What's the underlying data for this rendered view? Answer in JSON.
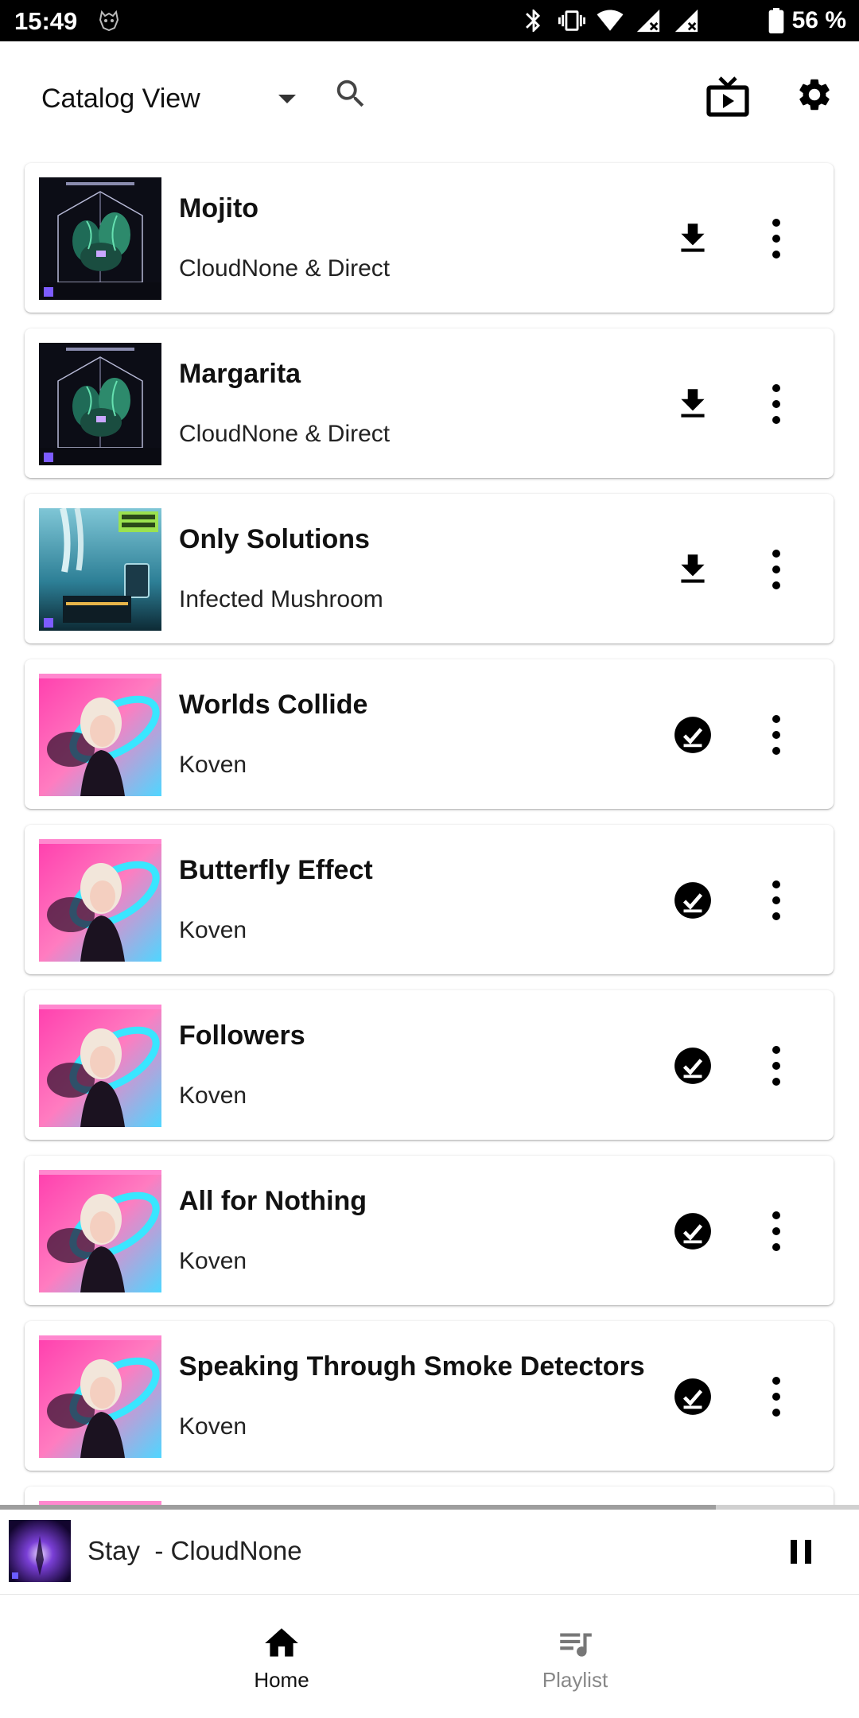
{
  "status_bar": {
    "time": "15:49",
    "battery": "56 %",
    "icons": [
      "app-icon",
      "bluetooth-icon",
      "vibrate-icon",
      "wifi-icon",
      "signal-icon",
      "signal-icon",
      "battery-icon"
    ]
  },
  "toolbar": {
    "view_label": "Catalog View",
    "icons": [
      "search-icon",
      "cast-tv-icon",
      "settings-gear-icon"
    ]
  },
  "tracks": [
    {
      "title": "Mojito",
      "artist": "CloudNone & Direct",
      "status": "download",
      "art": "terrarium"
    },
    {
      "title": "Margarita",
      "artist": "CloudNone & Direct",
      "status": "download",
      "art": "terrarium"
    },
    {
      "title": "Only Solutions",
      "artist": "Infected Mushroom",
      "status": "download",
      "art": "underwater"
    },
    {
      "title": "Worlds Collide",
      "artist": "Koven",
      "status": "downloaded",
      "art": "portrait"
    },
    {
      "title": "Butterfly Effect",
      "artist": "Koven",
      "status": "downloaded",
      "art": "portrait"
    },
    {
      "title": "Followers",
      "artist": "Koven",
      "status": "downloaded",
      "art": "portrait"
    },
    {
      "title": "All for Nothing",
      "artist": "Koven",
      "status": "downloaded",
      "art": "portrait"
    },
    {
      "title": "Speaking Through Smoke Detectors",
      "artist": "Koven",
      "status": "downloaded",
      "art": "portrait"
    }
  ],
  "player": {
    "now_playing": "Stay  - CloudNone",
    "progress": 0.833,
    "icons": [
      "pause-icon"
    ]
  },
  "nav": {
    "home_label": "Home",
    "playlist_label": "Playlist",
    "active": "home"
  },
  "colors": {
    "accent": "#000000",
    "inactive": "#888888",
    "status_bar": "#000000"
  }
}
